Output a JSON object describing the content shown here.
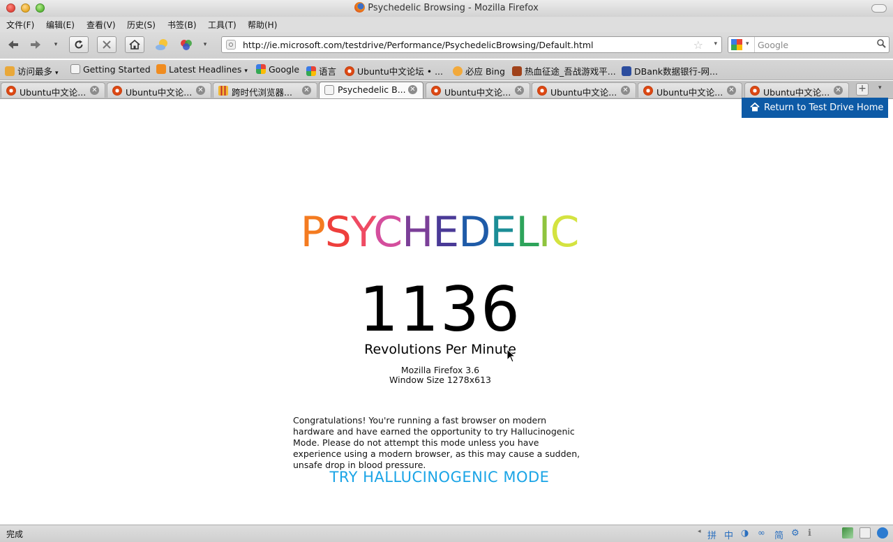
{
  "window": {
    "title": "Psychedelic Browsing - Mozilla Firefox"
  },
  "menu": [
    "文件(F)",
    "编辑(E)",
    "查看(V)",
    "历史(S)",
    "书签(B)",
    "工具(T)",
    "帮助(H)"
  ],
  "toolbar": {
    "url": "http://ie.microsoft.com/testdrive/Performance/PsychedelicBrowsing/Default.html",
    "search_placeholder": "Google"
  },
  "bookmarks": [
    "访问最多",
    "Getting Started",
    "Latest Headlines",
    "Google",
    "语言",
    "Ubuntu中文论坛 • ...",
    "必应 Bing",
    "热血征途_吾战游戏平...",
    "DBank数据银行-网..."
  ],
  "tabs": [
    {
      "label": "Ubuntu中文论...",
      "icon": "ubuntu-icon"
    },
    {
      "label": "Ubuntu中文论...",
      "icon": "ubuntu-icon"
    },
    {
      "label": "跨时代浏览器...",
      "icon": "bars-icon"
    },
    {
      "label": "Psychedelic B...",
      "icon": "page-icon",
      "active": true
    },
    {
      "label": "Ubuntu中文论...",
      "icon": "ubuntu-icon"
    },
    {
      "label": "Ubuntu中文论...",
      "icon": "ubuntu-icon"
    },
    {
      "label": "Ubuntu中文论...",
      "icon": "ubuntu-icon"
    },
    {
      "label": "Ubuntu中文论...",
      "icon": "ubuntu-icon"
    }
  ],
  "page": {
    "home_link": "Return to Test Drive Home",
    "title_letters": [
      {
        "ch": "P",
        "color": "#f47b20"
      },
      {
        "ch": "S",
        "color": "#ee3f3c"
      },
      {
        "ch": "Y",
        "color": "#ef4b63"
      },
      {
        "ch": "C",
        "color": "#d44e9d"
      },
      {
        "ch": "H",
        "color": "#7b3f98"
      },
      {
        "ch": "E",
        "color": "#4a3a97"
      },
      {
        "ch": "D",
        "color": "#1f5ba8"
      },
      {
        "ch": "E",
        "color": "#1b8d96"
      },
      {
        "ch": "L",
        "color": "#2ea45b"
      },
      {
        "ch": "I",
        "color": "#8fc43f"
      },
      {
        "ch": "C",
        "color": "#d4e340"
      }
    ],
    "rpm_value": "1136",
    "rpm_label": "Revolutions Per Minute",
    "browser_name": "Mozilla Firefox 3.6",
    "window_size": "Window Size 1278x613",
    "congrats_text": "Congratulations! You're running a fast browser on modern hardware and have earned the opportunity to try Hallucinogenic Mode. Please do not attempt this mode unless you have experience using a modern browser, as this may cause a sudden, unsafe drop in blood pressure.",
    "halluc_button": "TRY HALLUCINOGENIC MODE"
  },
  "status": {
    "text": "完成",
    "ime_icons": [
      "拼",
      "中",
      "◑",
      "∞",
      "简",
      "⚙",
      "ℹ"
    ]
  },
  "colors": {
    "home_link_bg": "#0d5aa6",
    "halluc_link": "#1aa4e6"
  }
}
